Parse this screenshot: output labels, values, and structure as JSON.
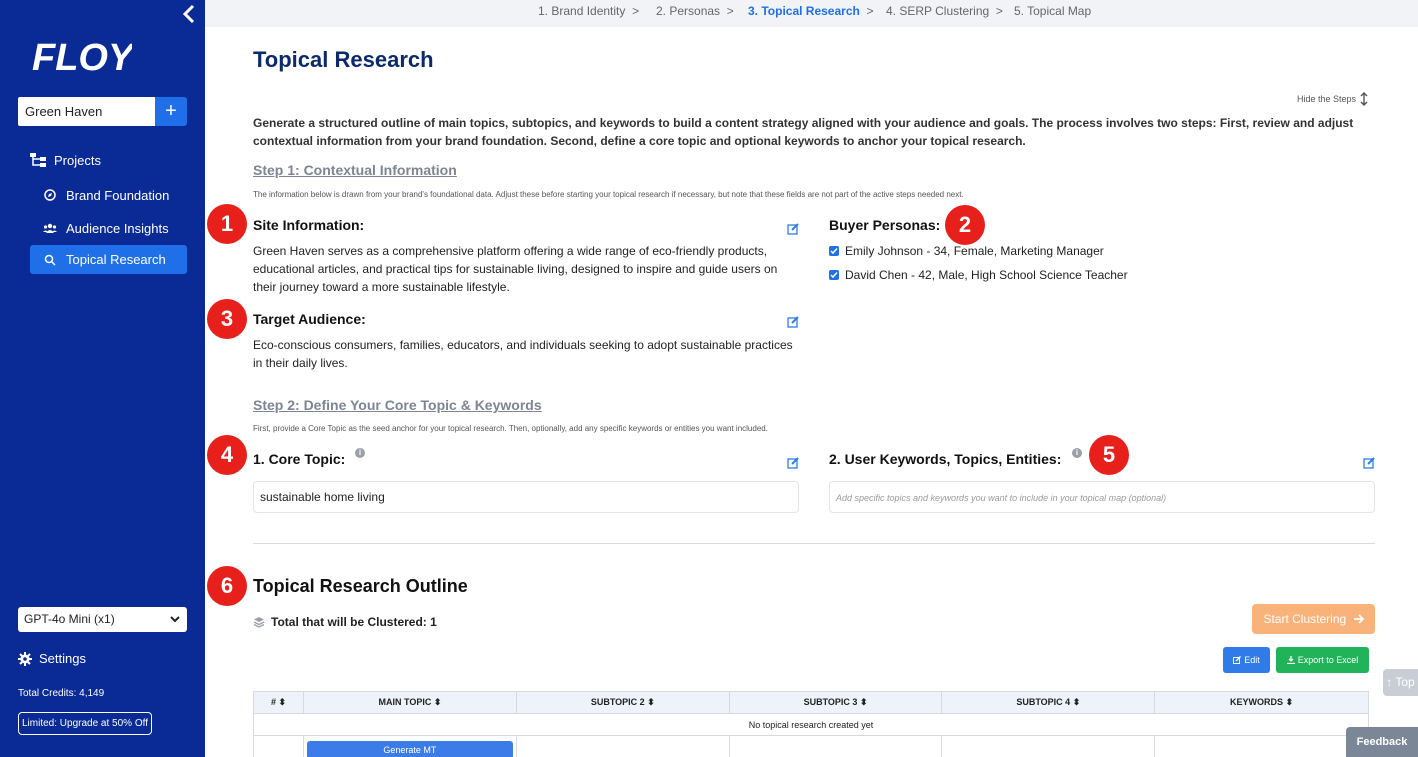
{
  "sidebar": {
    "logo": "FLOYI",
    "project": "Green Haven",
    "add_label": "+",
    "items": [
      {
        "label": "Projects"
      },
      {
        "label": "Brand Foundation"
      },
      {
        "label": "Audience Insights"
      },
      {
        "label": "Topical Research"
      }
    ],
    "model": "GPT-4o Mini (x1)",
    "settings": "Settings",
    "credits": "Total Credits: 4,149",
    "upgrade": "Limited: Upgrade at 50% Off"
  },
  "stepper": {
    "steps": [
      "1. Brand Identity",
      "2. Personas",
      "3. Topical Research",
      "4. SERP Clustering",
      "5. Topical Map"
    ],
    "sep": ">"
  },
  "main": {
    "title": "Topical Research",
    "hide_steps": "Hide the Steps",
    "intro": "Generate a structured outline of main topics, subtopics, and keywords to build a content strategy aligned with your audience and goals. The process involves two steps: First, review and adjust contextual information from your brand foundation. Second, define a core topic and optional keywords to anchor your topical research.",
    "step1": {
      "heading": "Step 1: Contextual Information",
      "note": "The information below is drawn from your brand's foundational data. Adjust these before starting your topical research if necessary, but note that these fields are not part of the active steps needed next.",
      "site_title": "Site Information:",
      "site_text": "Green Haven serves as a comprehensive platform offering a wide range of eco-friendly products, educational articles, and practical tips for sustainable living, designed to inspire and guide users on their journey toward a more sustainable lifestyle.",
      "audience_title": "Target Audience:",
      "audience_text": "Eco-conscious consumers, families, educators, and individuals seeking to adopt sustainable practices in their daily lives.",
      "personas_title": "Buyer Personas:",
      "personas": [
        "Emily Johnson - 34, Female, Marketing Manager",
        "David Chen - 42, Male, High School Science Teacher"
      ]
    },
    "step2": {
      "heading": "Step 2: Define Your Core Topic & Keywords",
      "note": "First, provide a Core Topic as the seed anchor for your topical research. Then, optionally, add any specific keywords or entities you want included.",
      "core_title": "1. Core Topic:",
      "core_value": "sustainable home living",
      "keywords_title": "2. User Keywords, Topics, Entities:",
      "keywords_placeholder": "Add specific topics and keywords you want to include in your topical map (optional)"
    },
    "badges": [
      "1",
      "2",
      "3",
      "4",
      "5",
      "6"
    ],
    "outline": {
      "title": "Topical Research Outline",
      "total": "Total that will be Clustered: 1",
      "start": "Start Clustering",
      "edit": "Edit",
      "export": "Export to Excel",
      "columns": [
        "#",
        "MAIN TOPIC",
        "SUBTOPIC 2",
        "SUBTOPIC 3",
        "SUBTOPIC 4",
        "KEYWORDS"
      ],
      "empty": "No topical research created yet",
      "generate": "Generate MT"
    },
    "top": "Top",
    "feedback": "Feedback"
  },
  "colors": {
    "sidebar": "#0a2a96",
    "accent": "#1f6fe8",
    "badge": "#e8201c",
    "start": "#f9b27a",
    "export": "#21b35a"
  }
}
